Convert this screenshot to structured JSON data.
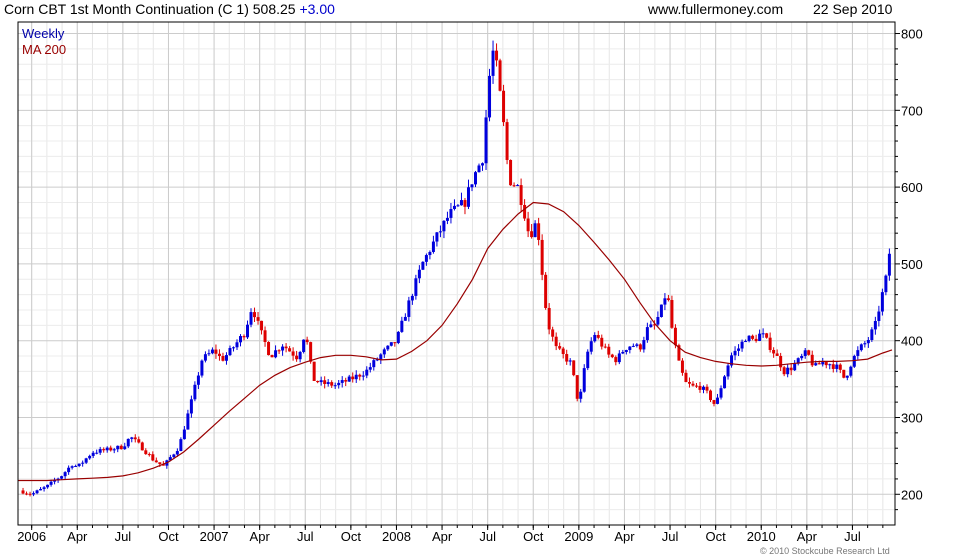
{
  "header": {
    "title": "Corn CBT 1st Month Continuation (C 1)",
    "price": "508.25",
    "change": "+3.00",
    "site": "www.fullermoney.com",
    "date": "22 Sep 2010"
  },
  "legend": {
    "series1": "Weekly",
    "series2": "MA 200"
  },
  "copyright": "© 2010 Stockcube Research Ltd",
  "colors": {
    "up": "#0000dd",
    "down": "#dd0000",
    "ma": "#990000",
    "grid": "#cccccc",
    "axis": "#000000"
  },
  "chart_data": {
    "type": "candlestick",
    "title": "Corn CBT 1st Month Continuation (C 1)",
    "frequency": "Weekly",
    "ylim": [
      160,
      815
    ],
    "y_ticks": [
      200,
      300,
      400,
      500,
      600,
      700,
      800
    ],
    "x_tick_labels": [
      "2006",
      "Apr",
      "Jul",
      "Oct",
      "2007",
      "Apr",
      "Jul",
      "Oct",
      "2008",
      "Apr",
      "Jul",
      "Oct",
      "2009",
      "Apr",
      "Jul",
      "Oct",
      "2010",
      "Apr",
      "Jul"
    ],
    "x_tick_months": [
      0,
      3,
      6,
      9,
      12,
      15,
      18,
      21,
      24,
      27,
      30,
      33,
      36,
      39,
      42,
      45,
      48,
      51,
      54
    ],
    "x_range_months": [
      -0.9,
      56.8
    ],
    "grid": true,
    "legend_position": "top-left",
    "price_path": [
      [
        -0.8,
        205
      ],
      [
        0,
        200
      ],
      [
        1,
        210
      ],
      [
        2,
        225
      ],
      [
        2.7,
        240
      ],
      [
        3,
        235
      ],
      [
        4,
        255
      ],
      [
        5,
        258
      ],
      [
        6,
        262
      ],
      [
        6.5,
        275
      ],
      [
        7.3,
        260
      ],
      [
        8,
        245
      ],
      [
        8.7,
        236
      ],
      [
        9,
        245
      ],
      [
        9.7,
        262
      ],
      [
        10.5,
        320
      ],
      [
        11.2,
        375
      ],
      [
        12,
        388
      ],
      [
        12.5,
        375
      ],
      [
        13,
        385
      ],
      [
        14,
        410
      ],
      [
        14.5,
        445
      ],
      [
        15,
        415
      ],
      [
        15.7,
        380
      ],
      [
        16.5,
        395
      ],
      [
        17.5,
        378
      ],
      [
        18,
        412
      ],
      [
        18.5,
        350
      ],
      [
        19,
        345
      ],
      [
        20,
        342
      ],
      [
        21,
        350
      ],
      [
        22,
        360
      ],
      [
        23,
        382
      ],
      [
        24,
        400
      ],
      [
        25,
        460
      ],
      [
        25.7,
        500
      ],
      [
        26.5,
        530
      ],
      [
        27.5,
        565
      ],
      [
        28.5,
        580
      ],
      [
        29,
        610
      ],
      [
        29.7,
        640
      ],
      [
        30,
        720
      ],
      [
        30.3,
        780
      ],
      [
        30.6,
        755
      ],
      [
        31,
        690
      ],
      [
        31.4,
        610
      ],
      [
        32,
        600
      ],
      [
        32.5,
        560
      ],
      [
        32.8,
        530
      ],
      [
        33,
        555
      ],
      [
        33.3,
        545
      ],
      [
        33.5,
        510
      ],
      [
        33.7,
        460
      ],
      [
        34,
        420
      ],
      [
        34.5,
        390
      ],
      [
        35,
        380
      ],
      [
        35.5,
        370
      ],
      [
        36,
        315
      ],
      [
        36.5,
        380
      ],
      [
        37,
        410
      ],
      [
        37.5,
        395
      ],
      [
        38,
        380
      ],
      [
        38.5,
        375
      ],
      [
        39,
        390
      ],
      [
        39.5,
        395
      ],
      [
        40,
        390
      ],
      [
        40.5,
        415
      ],
      [
        41,
        420
      ],
      [
        41.5,
        445
      ],
      [
        41.8,
        468
      ],
      [
        42,
        430
      ],
      [
        42.5,
        375
      ],
      [
        43,
        345
      ],
      [
        43.5,
        340
      ],
      [
        44,
        340
      ],
      [
        44.5,
        330
      ],
      [
        45,
        315
      ],
      [
        45.5,
        350
      ],
      [
        46,
        380
      ],
      [
        46.5,
        390
      ],
      [
        47,
        405
      ],
      [
        47.5,
        400
      ],
      [
        48,
        410
      ],
      [
        48.5,
        395
      ],
      [
        49,
        380
      ],
      [
        49.5,
        360
      ],
      [
        50,
        365
      ],
      [
        50.5,
        375
      ],
      [
        51,
        385
      ],
      [
        51.5,
        365
      ],
      [
        52,
        372
      ],
      [
        52.5,
        370
      ],
      [
        53,
        365
      ],
      [
        53.5,
        350
      ],
      [
        54,
        375
      ],
      [
        54.5,
        390
      ],
      [
        55,
        400
      ],
      [
        55.5,
        420
      ],
      [
        55.9,
        455
      ],
      [
        56.2,
        480
      ],
      [
        56.4,
        515
      ],
      [
        56.6,
        508
      ]
    ],
    "ma_200": [
      [
        -0.9,
        218
      ],
      [
        0,
        218
      ],
      [
        1,
        218
      ],
      [
        2,
        219
      ],
      [
        3,
        220
      ],
      [
        4,
        221
      ],
      [
        5,
        222
      ],
      [
        6,
        224
      ],
      [
        7,
        228
      ],
      [
        8,
        234
      ],
      [
        9,
        242
      ],
      [
        10,
        255
      ],
      [
        11,
        272
      ],
      [
        12,
        290
      ],
      [
        13,
        308
      ],
      [
        14,
        325
      ],
      [
        15,
        342
      ],
      [
        16,
        355
      ],
      [
        17,
        365
      ],
      [
        18,
        372
      ],
      [
        19,
        378
      ],
      [
        20,
        381
      ],
      [
        21,
        381
      ],
      [
        22,
        379
      ],
      [
        23,
        375
      ],
      [
        24,
        376
      ],
      [
        25,
        386
      ],
      [
        26,
        400
      ],
      [
        27,
        420
      ],
      [
        28,
        448
      ],
      [
        29,
        480
      ],
      [
        30,
        520
      ],
      [
        31,
        545
      ],
      [
        32,
        565
      ],
      [
        33,
        580
      ],
      [
        34,
        578
      ],
      [
        35,
        568
      ],
      [
        36,
        550
      ],
      [
        37,
        528
      ],
      [
        38,
        505
      ],
      [
        39,
        480
      ],
      [
        40,
        450
      ],
      [
        41,
        422
      ],
      [
        42,
        400
      ],
      [
        43,
        385
      ],
      [
        44,
        378
      ],
      [
        45,
        373
      ],
      [
        46,
        370
      ],
      [
        47,
        368
      ],
      [
        48,
        367
      ],
      [
        49,
        368
      ],
      [
        50,
        370
      ],
      [
        51,
        372
      ],
      [
        52,
        373
      ],
      [
        53,
        373
      ],
      [
        54,
        374
      ],
      [
        55,
        376
      ],
      [
        56,
        384
      ],
      [
        56.6,
        388
      ]
    ],
    "y_axis_side": "right"
  }
}
